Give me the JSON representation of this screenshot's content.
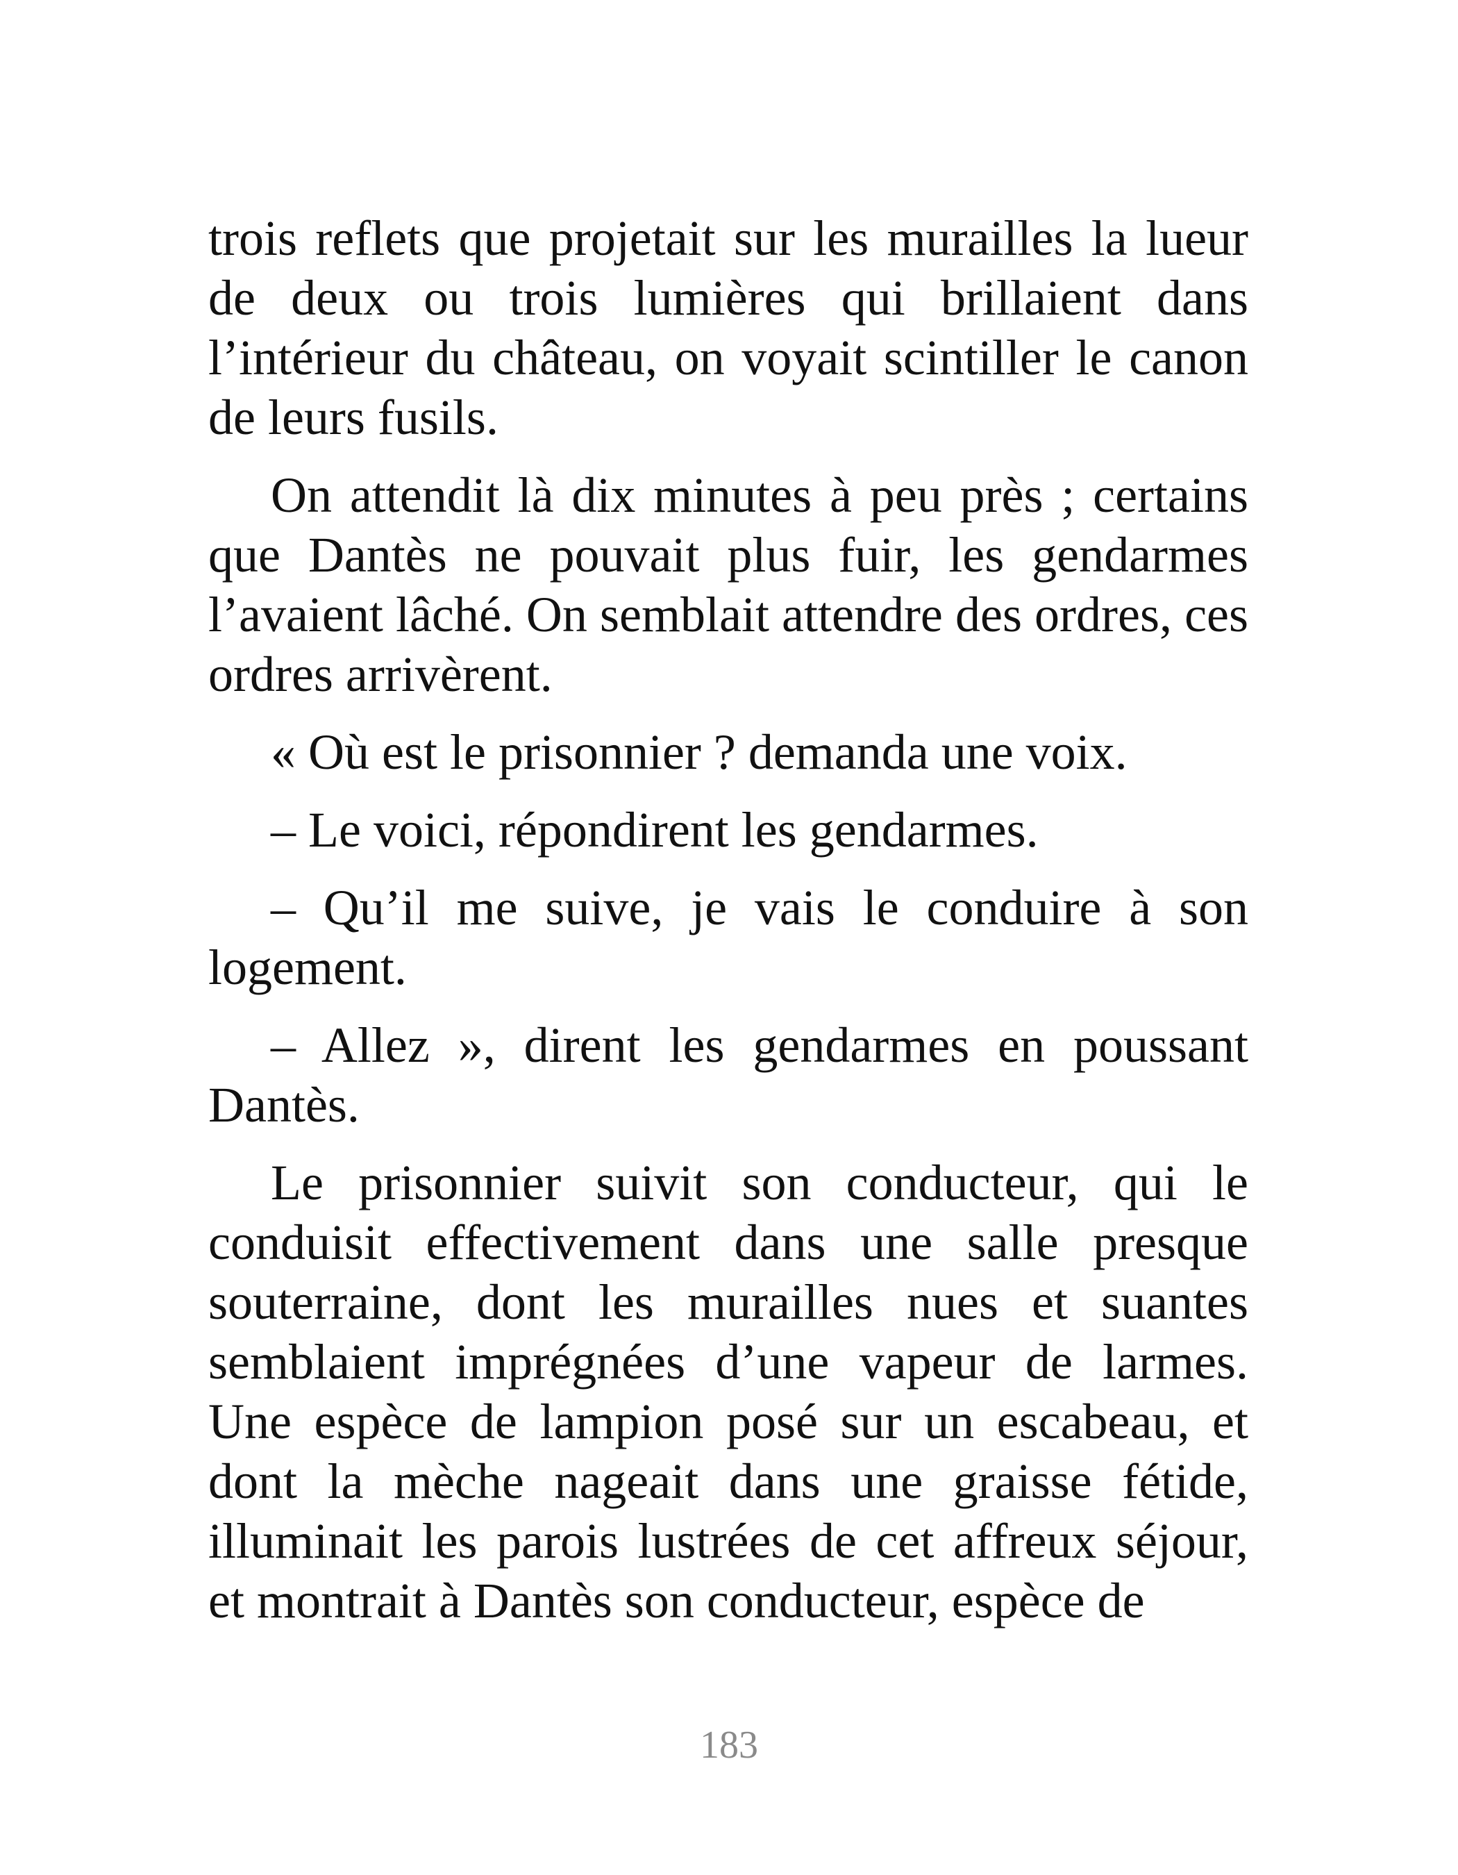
{
  "page": {
    "paragraphs": [
      "trois reflets que projetait sur les murailles la lueur de deux ou trois lumières qui brillaient dans l’intérieur du château, on voyait scintiller le canon de leurs fusils.",
      "On attendit là dix minutes à peu près ; certains que Dantès ne pouvait plus fuir, les gendarmes l’avaient lâché. On semblait attendre des ordres, ces ordres arrivèrent.",
      "« Où est le prisonnier ? demanda une voix.",
      "– Le voici, répondirent les gendarmes.",
      "– Qu’il me suive, je vais le conduire à son logement.",
      "– Allez », dirent les gendarmes en poussant Dantès.",
      "Le prisonnier suivit son conducteur, qui le conduisit effectivement dans une salle presque souterraine, dont les murailles nues et suantes semblaient imprégnées d’une vapeur de larmes. Une espèce de lampion posé sur un escabeau, et dont la mèche nageait dans une graisse fétide, illuminait les parois lustrées de cet affreux séjour, et montrait à Dantès son conducteur, espèce de"
    ],
    "page_number": "183"
  }
}
